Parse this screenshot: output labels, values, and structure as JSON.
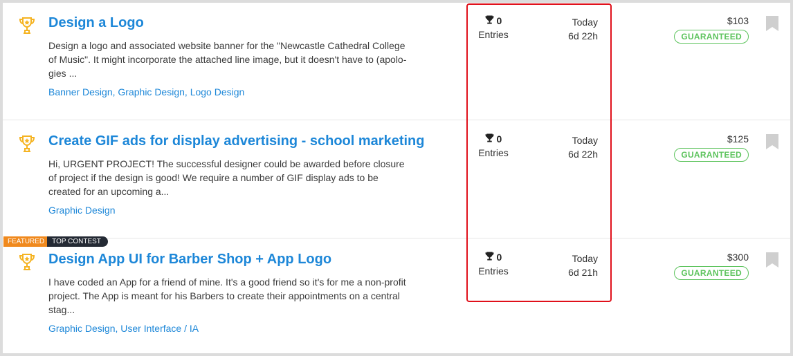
{
  "contests": [
    {
      "title": "Design a Logo",
      "description": "Design a logo and associated website banner for the \"Newcastle Cathedral College of Music\". It might incorporate the attached line image, but it doesn't have to (apolo-gies ...",
      "tags": [
        "Banner Design",
        "Graphic Design",
        "Logo Design"
      ],
      "entries_count": "0",
      "entries_label": "Entries",
      "time_label": "Today",
      "time_remaining": "6d 22h",
      "prize": "$103",
      "badge": "GUARANTEED",
      "ribbons": []
    },
    {
      "title": "Create GIF ads for display advertising - school marketing",
      "description": "Hi, URGENT PROJECT! The successful designer could be awarded before closure of project if the design is good! We require a number of GIF display ads to be created for an upcoming a...",
      "tags": [
        "Graphic Design"
      ],
      "entries_count": "0",
      "entries_label": "Entries",
      "time_label": "Today",
      "time_remaining": "6d 22h",
      "prize": "$125",
      "badge": "GUARANTEED",
      "ribbons": []
    },
    {
      "title": "Design App UI for Barber Shop + App Logo",
      "description": "I have coded an App for a friend of mine. It's a good friend so it's for me a non-profit project. The App is meant for his Barbers to create their appointments on a central stag...",
      "tags": [
        "Graphic Design",
        "User Interface / IA"
      ],
      "entries_count": "0",
      "entries_label": "Entries",
      "time_label": "Today",
      "time_remaining": "6d 21h",
      "prize": "$300",
      "badge": "GUARANTEED",
      "ribbons": [
        "FEATURED",
        "TOP CONTEST"
      ]
    }
  ],
  "icons": {
    "contest": "trophy-icon",
    "entries": "trophy-icon",
    "bookmark": "bookmark-icon"
  },
  "colors": {
    "link": "#1d87d8",
    "trophy": "#f5b321",
    "guaranteed": "#5cc35c",
    "featured": "#f0891d",
    "top_contest": "#242a34",
    "highlight": "#e0101a",
    "bookmark": "#cfcfcf"
  }
}
